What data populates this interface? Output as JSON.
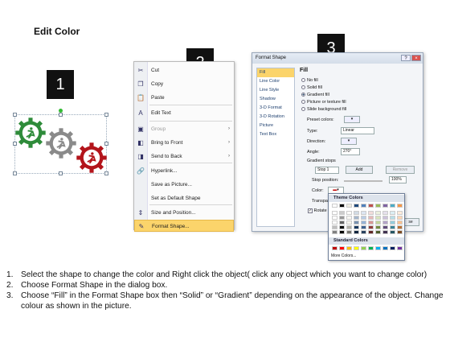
{
  "title": "Edit Color",
  "step_badges": [
    "1",
    "2",
    "3"
  ],
  "context_menu": {
    "items": [
      {
        "label": "Cut",
        "icon": "scissors-icon",
        "glyph": "✂",
        "disabled": false,
        "submenu": false
      },
      {
        "label": "Copy",
        "icon": "copy-icon",
        "glyph": "❐",
        "disabled": false,
        "submenu": false
      },
      {
        "label": "Paste",
        "icon": "paste-icon",
        "glyph": "📋",
        "disabled": false,
        "submenu": false
      },
      {
        "label": "Edit Text",
        "icon": "edit-text-icon",
        "glyph": "A",
        "disabled": false,
        "submenu": false
      },
      {
        "label": "Group",
        "icon": "group-icon",
        "glyph": "▣",
        "disabled": true,
        "submenu": true
      },
      {
        "label": "Bring to Front",
        "icon": "bring-front-icon",
        "glyph": "◧",
        "disabled": false,
        "submenu": true
      },
      {
        "label": "Send to Back",
        "icon": "send-back-icon",
        "glyph": "◨",
        "disabled": false,
        "submenu": true
      },
      {
        "label": "Hyperlink...",
        "icon": "hyperlink-icon",
        "glyph": "🔗",
        "disabled": false,
        "submenu": false
      },
      {
        "label": "Save as Picture...",
        "icon": "",
        "glyph": "",
        "disabled": false,
        "submenu": false
      },
      {
        "label": "Set as Default Shape",
        "icon": "",
        "glyph": "",
        "disabled": false,
        "submenu": false
      },
      {
        "label": "Size and Position...",
        "icon": "size-position-icon",
        "glyph": "⇕",
        "disabled": false,
        "submenu": false
      },
      {
        "label": "Format Shape...",
        "icon": "format-shape-icon",
        "glyph": "✎",
        "disabled": false,
        "submenu": false,
        "highlighted": true
      }
    ]
  },
  "dialog": {
    "title": "Format Shape",
    "nav": [
      "Fill",
      "Line Color",
      "Line Style",
      "Shadow",
      "3-D Format",
      "3-D Rotation",
      "Picture",
      "Text Box"
    ],
    "pane_heading": "Fill",
    "fill_options": [
      {
        "label": "No fill",
        "selected": false
      },
      {
        "label": "Solid fill",
        "selected": false
      },
      {
        "label": "Gradient fill",
        "selected": true
      },
      {
        "label": "Picture or texture fill",
        "selected": false
      },
      {
        "label": "Slide background fill",
        "selected": false
      }
    ],
    "preset_colors_label": "Preset colors:",
    "type_label": "Type:",
    "type_value": "Linear",
    "direction_label": "Direction:",
    "angle_label": "Angle:",
    "angle_value": "270°",
    "gradient_stops_label": "Gradient stops",
    "stop_value": "Stop 1",
    "add_label": "Add",
    "remove_label": "Remove",
    "stop_position_label": "Stop position:",
    "stop_position_value": "100%",
    "color_label": "Color:",
    "transparency_label": "Transpa",
    "rotate_label": "Rotate",
    "close_label": "se",
    "window_buttons": [
      "?",
      "×"
    ]
  },
  "color_popup": {
    "theme_heading": "Theme Colors",
    "standard_heading": "Standard Colors",
    "more_label": "More Colors...",
    "theme_top": [
      "#ffffff",
      "#000000",
      "#eeece1",
      "#1f497d",
      "#4f81bd",
      "#c0504d",
      "#9bbb59",
      "#8064a2",
      "#4bacc6",
      "#f79646"
    ],
    "standard": [
      "#c00000",
      "#ff0000",
      "#ffc000",
      "#ffff00",
      "#92d050",
      "#00b050",
      "#00b0f0",
      "#0070c0",
      "#002060",
      "#7030a0"
    ]
  },
  "gear_colors": {
    "green": "#2e8b3a",
    "gray": "#8a8a8a",
    "red": "#b3141b"
  },
  "instructions": [
    {
      "num": "1.",
      "text": "Select the shape to change the color and Right click the object( click any object which you want to change color)"
    },
    {
      "num": "2.",
      "text": "Choose Format Shape in the dialog box."
    },
    {
      "num": "3.",
      "text": "Choose “Fill” in the Format Shape box then “Solid” or “Gradient” depending on the appearance of the object. Change colour as shown in the picture."
    }
  ]
}
